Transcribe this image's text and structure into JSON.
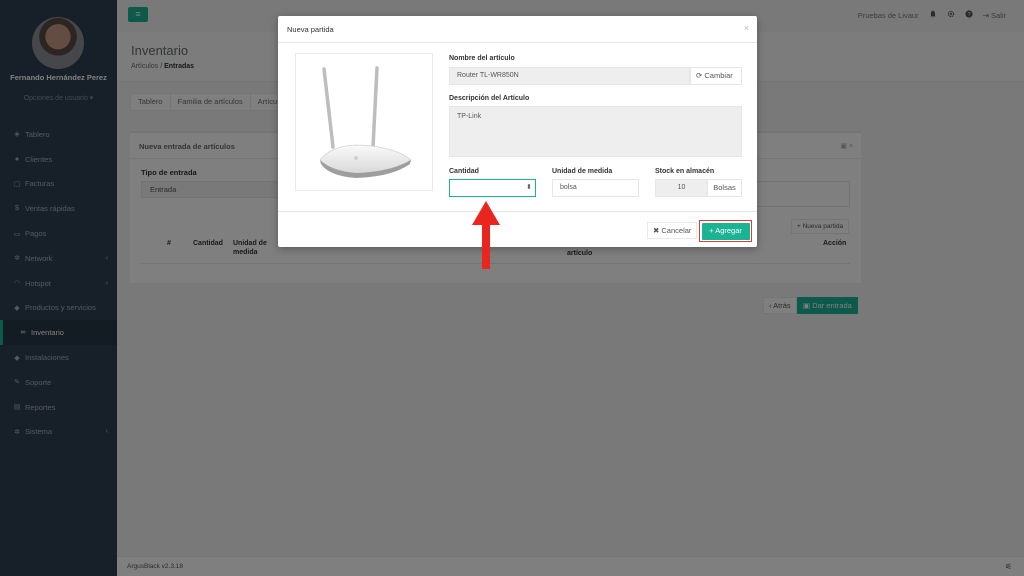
{
  "sidebar": {
    "user_name": "Fernando Hernández Perez",
    "user_options": "Opciones de usuario ▾",
    "items": [
      {
        "label": "Tablero",
        "icon": "dashboard-icon",
        "glyph": "◈"
      },
      {
        "label": "Clientes",
        "icon": "users-icon",
        "glyph": "●"
      },
      {
        "label": "Facturas",
        "icon": "file-icon",
        "glyph": "▢"
      },
      {
        "label": "Ventas rápidas",
        "icon": "dollar-icon",
        "glyph": "$"
      },
      {
        "label": "Pagos",
        "icon": "card-icon",
        "glyph": "▭"
      },
      {
        "label": "Network",
        "icon": "network-icon",
        "glyph": "✲",
        "chevron": "‹"
      },
      {
        "label": "Hotspot",
        "icon": "wifi-icon",
        "glyph": "◠",
        "chevron": "‹"
      },
      {
        "label": "Productos y servicios",
        "icon": "box-icon",
        "glyph": "◆"
      },
      {
        "label": "Inventario",
        "icon": "link-icon",
        "glyph": "∞",
        "active": true
      },
      {
        "label": "Instalaciones",
        "icon": "tag-icon",
        "glyph": "◆"
      },
      {
        "label": "Soporte",
        "icon": "wrench-icon",
        "glyph": "✎"
      },
      {
        "label": "Reportes",
        "icon": "book-icon",
        "glyph": "▤"
      },
      {
        "label": "Sistema",
        "icon": "cogs-icon",
        "glyph": "✲",
        "chevron": "‹"
      }
    ]
  },
  "topbar": {
    "menu_glyph": "≡",
    "account": "Pruebas de Livaur",
    "logout": "Salir"
  },
  "header": {
    "title": "Inventario",
    "crumb_1": "Artículos",
    "crumb_sep": "/",
    "crumb_2": "Entradas"
  },
  "tabs": [
    "Tablero",
    "Familia de artículos",
    "Artícu"
  ],
  "panel": {
    "title": "Nueva entrada de artículos",
    "tipo_label": "Tipo de entrada",
    "tipo_value": "Entrada",
    "nueva_partida": "Nueva partida",
    "columns": {
      "num": "#",
      "cantidad": "Cantidad",
      "unidad": "Unidad de medida",
      "articulo": "artículo",
      "accion": "Acción"
    },
    "btn_atras": "Atrás",
    "btn_dar": "Dar entrada"
  },
  "footer": {
    "version": "ArgusBlack v2.3.18"
  },
  "modal": {
    "title": "Nueva partida",
    "close": "×",
    "nombre_label": "Nombre del artículo",
    "nombre_value": "Router TL-WR850N",
    "cambiar": "Cambiar",
    "descripcion_label": "Descripción del Artículo",
    "descripcion_value": "TP-Link",
    "cantidad_label": "Cantidad",
    "cantidad_value": "",
    "unidad_label": "Unidad de medida",
    "unidad_value": "bolsa",
    "stock_label": "Stock en almacén",
    "stock_value": "10",
    "stock_unit": "Bolsas",
    "btn_cancelar": "Cancelar",
    "btn_agregar": "Agregar"
  },
  "colors": {
    "accent": "#1ab394",
    "sidebar": "#2f4050",
    "highlight": "#e53935",
    "arrow": "#e8251f"
  }
}
